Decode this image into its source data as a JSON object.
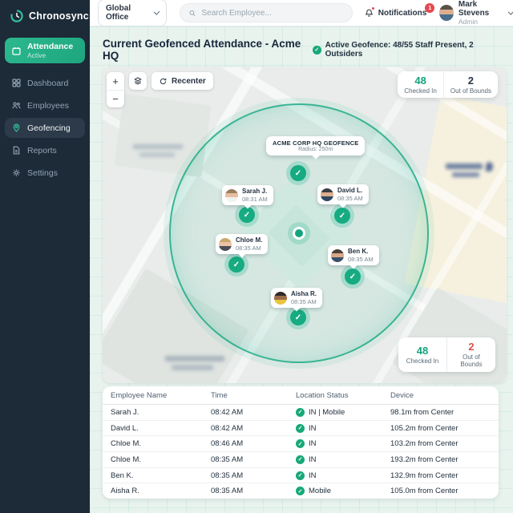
{
  "app": {
    "name": "Chronosync"
  },
  "topbar": {
    "office_selector": "Global Office",
    "search_placeholder": "Search Employee...",
    "notifications_label": "Notifications",
    "notifications_count": "1",
    "user_name": "Mark Stevens",
    "user_role": "Admin"
  },
  "sidebar": {
    "items": [
      {
        "label": "Attendance",
        "sublabel": "Active"
      },
      {
        "label": "Dashboard"
      },
      {
        "label": "Employees"
      },
      {
        "label": "Geofencing"
      },
      {
        "label": "Reports"
      },
      {
        "label": "Settings"
      }
    ]
  },
  "header": {
    "title": "Current Geofenced Attendance - Acme HQ",
    "status_badge": "Active Geofence: 48/55 Staff Present, 2 Outsiders"
  },
  "map": {
    "controls": {
      "zoom_in": "+",
      "zoom_out": "−",
      "recenter": "Recenter"
    },
    "geofence": {
      "name": "ACME CORP HQ GEOFENCE",
      "radius_label": "Radius: 250m"
    },
    "markers": [
      {
        "name": "Sarah J.",
        "time": "08:31 AM"
      },
      {
        "name": "David L.",
        "time": "08:35 AM"
      },
      {
        "name": "Chloe M.",
        "time": "08:35 AM"
      },
      {
        "name": "Ben K.",
        "time": "08:35 AM"
      },
      {
        "name": "Aisha R.",
        "time": "08:35 AM"
      }
    ],
    "stats": {
      "checked_in_value": "48",
      "checked_in_label": "Checked In",
      "out_of_bounds_value": "2",
      "out_of_bounds_label": "Out of Bounds"
    }
  },
  "table": {
    "columns": [
      "Employee Name",
      "Time",
      "Location Status",
      "Device"
    ],
    "rows": [
      {
        "name": "Sarah J.",
        "time": "08:42 AM",
        "status": "IN | Mobile",
        "device": "98.1m from Center"
      },
      {
        "name": "David L.",
        "time": "08:42 AM",
        "status": "IN",
        "device": "105.2m from Center"
      },
      {
        "name": "Chloe M.",
        "time": "08:46 AM",
        "status": "IN",
        "device": "103.2m from Center"
      },
      {
        "name": "Chloe M.",
        "time": "08:35 AM",
        "status": "IN",
        "device": "193.2m from Center"
      },
      {
        "name": "Ben K.",
        "time": "08:35 AM",
        "status": "IN",
        "device": "132.9m from Center"
      },
      {
        "name": "Aisha R.",
        "time": "08:35 AM",
        "status": "Mobile",
        "device": "105.0m from Center"
      }
    ]
  },
  "colors": {
    "accent": "#1ea67e",
    "sidebar_bg": "#1d2a38",
    "success": "#17a879",
    "danger": "#e5484d"
  },
  "icons": {
    "check": "✓"
  }
}
